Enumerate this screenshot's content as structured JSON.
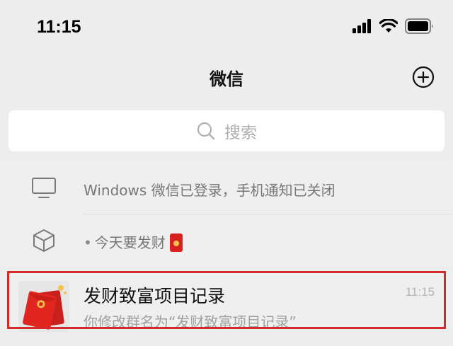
{
  "status_bar": {
    "time": "11:15",
    "icons": [
      "signal-icon",
      "wifi-icon",
      "battery-icon"
    ]
  },
  "nav": {
    "title": "微信",
    "add_icon": "plus-circle-icon"
  },
  "search": {
    "placeholder": "搜索",
    "icon": "search-icon"
  },
  "system_rows": [
    {
      "icon": "monitor-icon",
      "text": "Windows 微信已登录，手机通知已关闭"
    },
    {
      "icon": "cube-icon",
      "text": "今天要发财",
      "bullet": "•",
      "badge_icon": "red-envelope-icon"
    }
  ],
  "chat": {
    "title": "发财致富项目记录",
    "time": "11:15",
    "preview": "你修改群名为“发财致富项目记录”",
    "avatar_icon": "red-envelope-avatar-icon"
  },
  "colors": {
    "background": "#ededed",
    "highlight": "#d42a2a",
    "red_envelope": "#d8201e",
    "gold": "#f4c44a"
  }
}
